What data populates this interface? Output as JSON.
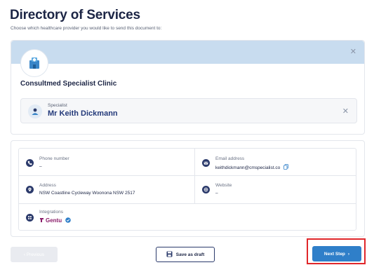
{
  "header": {
    "title": "Directory of Services",
    "subtitle": "Choose which healthcare provider you would like to send this document to:"
  },
  "provider_card": {
    "close_icon": "close-icon",
    "clinic_name": "Consultmed Specialist Clinic",
    "specialist_role": "Specialist",
    "specialist_name": "Mr Keith Dickmann",
    "remove_icon": "close-icon"
  },
  "details": {
    "phone_label": "Phone number",
    "phone_value": "–",
    "email_label": "Email address",
    "email_value": "keithdickmann@cmspecialist.co",
    "address_label": "Address",
    "address_value": "NSW Coastline Cycleway Woonona NSW 2517",
    "website_label": "Website",
    "website_value": "–",
    "integrations_label": "Integrations",
    "integrations_value": "Gentu"
  },
  "footer": {
    "previous_label": "Previous",
    "draft_label": "Save as draft",
    "next_label": "Next Step"
  },
  "colors": {
    "banner": "#c8dcef",
    "primary": "#2f7fc9",
    "navy": "#1c2545",
    "highlight": "#e0262a",
    "integration": "#8b1e6b",
    "verified": "#2f7fc9"
  }
}
